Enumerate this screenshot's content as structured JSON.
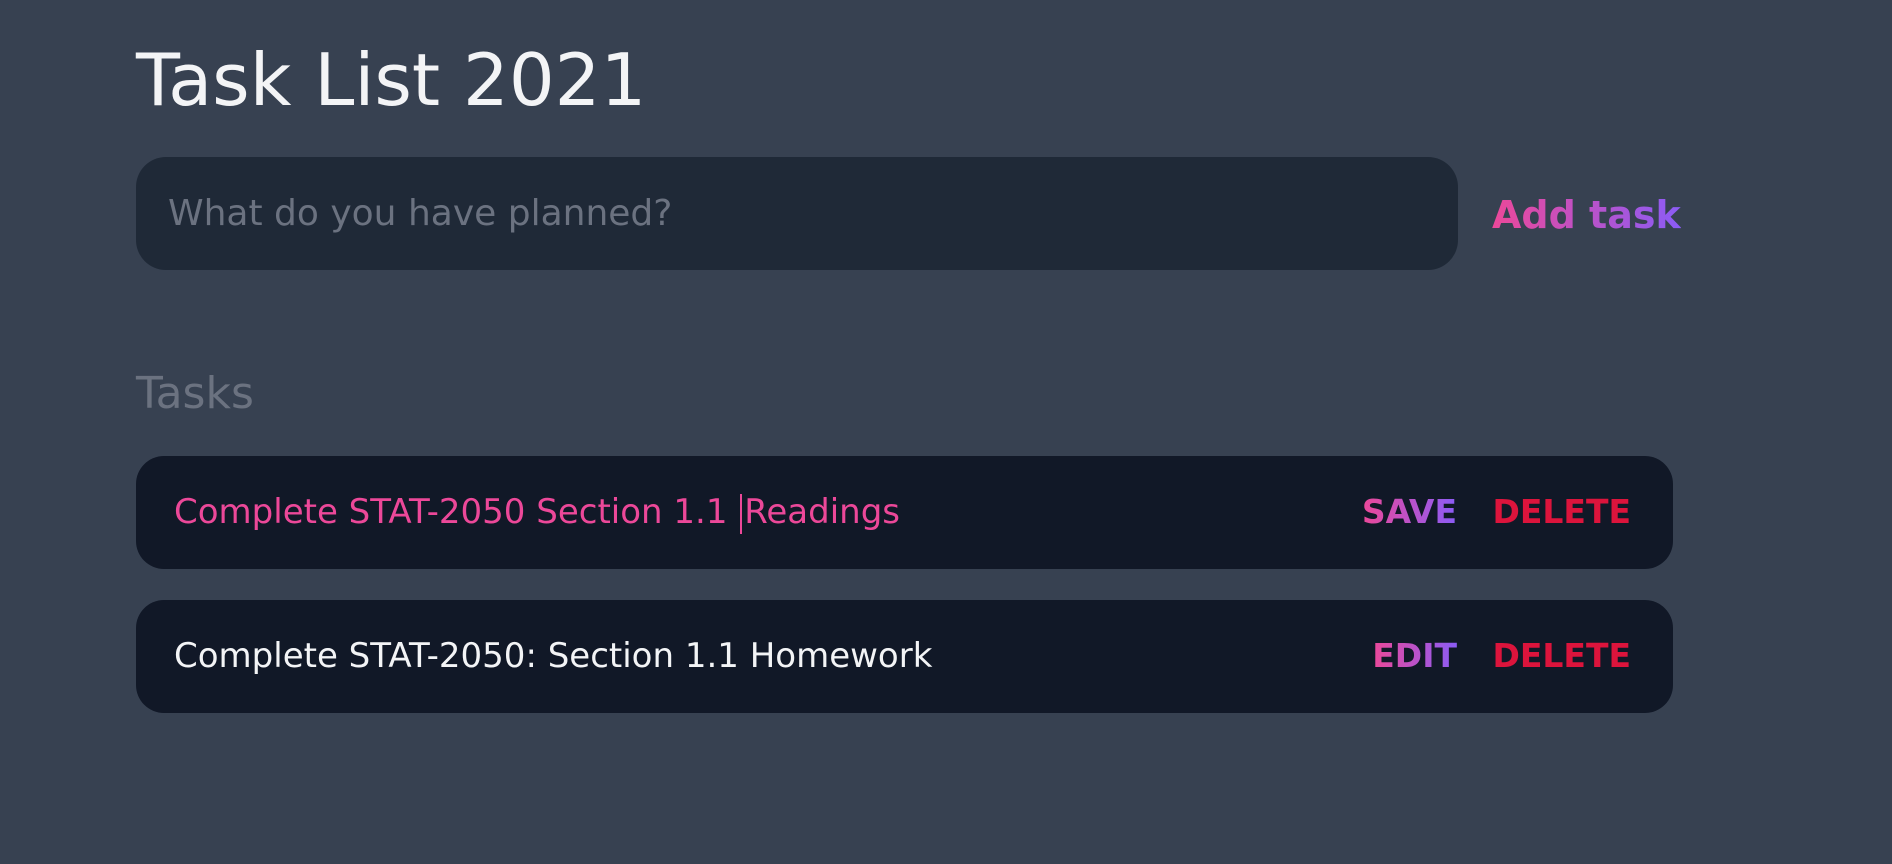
{
  "header": {
    "title": "Task List 2021"
  },
  "new_task": {
    "placeholder": "What do you have planned?",
    "add_label": "Add task"
  },
  "tasks_section": {
    "title": "Tasks",
    "items": [
      {
        "text_before_caret": "Complete STAT-2050 Section 1.1 ",
        "text_after_caret": "Readings",
        "primary_action": "SAVE",
        "delete_label": "DELETE",
        "editing": true
      },
      {
        "text": "Complete STAT-2050: Section 1.1 Homework",
        "primary_action": "EDIT",
        "delete_label": "DELETE",
        "editing": false
      }
    ]
  },
  "colors": {
    "background": "#374151",
    "input_background": "#1f2937",
    "task_background": "#111827",
    "accent_pink": "#ec4899",
    "accent_purple": "#8b5cf6",
    "delete_red": "#dc143c"
  }
}
